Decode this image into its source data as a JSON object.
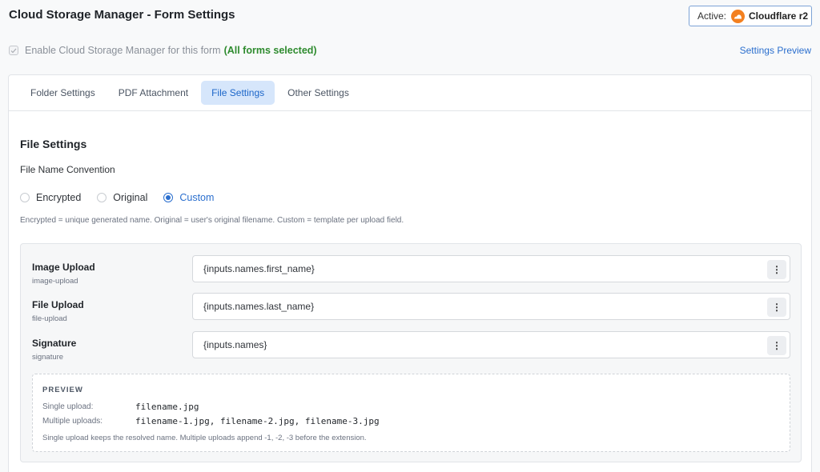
{
  "header": {
    "title": "Cloud Storage Manager - Form Settings",
    "active_label": "Active:",
    "provider": "Cloudflare r2",
    "provider_icon": "cloudflare-icon",
    "provider_color": "#f38020"
  },
  "enable": {
    "label": "Enable Cloud Storage Manager for this form",
    "note": "(All forms selected)",
    "checked": true
  },
  "settings_preview_link": "Settings Preview",
  "tabs": [
    {
      "label": "Folder Settings",
      "active": false
    },
    {
      "label": "PDF Attachment",
      "active": false
    },
    {
      "label": "File Settings",
      "active": true
    },
    {
      "label": "Other Settings",
      "active": false
    }
  ],
  "file_settings": {
    "title": "File Settings",
    "convention_label": "File Name Convention",
    "options": [
      {
        "label": "Encrypted",
        "selected": false
      },
      {
        "label": "Original",
        "selected": false
      },
      {
        "label": "Custom",
        "selected": true
      }
    ],
    "help": "Encrypted = unique generated name. Original = user's original filename. Custom = template per upload field.",
    "fields": [
      {
        "name": "Image Upload",
        "slug": "image-upload",
        "value": "{inputs.names.first_name}"
      },
      {
        "name": "File Upload",
        "slug": "file-upload",
        "value": "{inputs.names.last_name}"
      },
      {
        "name": "Signature",
        "slug": "signature",
        "value": "{inputs.names}"
      }
    ],
    "menu_icon": "more-vertical-icon",
    "preview": {
      "title": "PREVIEW",
      "single_label": "Single upload:",
      "single_value": "filename.jpg",
      "multiple_label": "Multiple uploads:",
      "multiple_value": "filename-1.jpg, filename-2.jpg, filename-3.jpg",
      "note": "Single upload keeps the resolved name. Multiple uploads append -1, -2, -3 before the extension."
    }
  },
  "colors": {
    "accent": "#2b6fce",
    "success": "#2e8b2e",
    "active_tab_bg": "#d6e6fb"
  }
}
